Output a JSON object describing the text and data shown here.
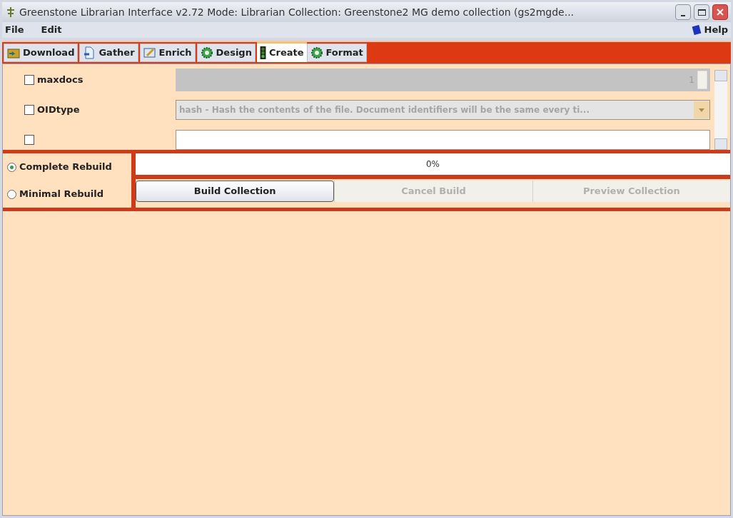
{
  "window": {
    "title": "Greenstone Librarian Interface v2.72  Mode: Librarian  Collection: Greenstone2 MG demo collection (gs2mgde..."
  },
  "menu": {
    "items": [
      "File",
      "Edit"
    ],
    "help": "Help"
  },
  "tabs": [
    {
      "label": "Download",
      "selected": false
    },
    {
      "label": "Gather",
      "selected": false
    },
    {
      "label": "Enrich",
      "selected": false
    },
    {
      "label": "Design",
      "selected": false
    },
    {
      "label": "Create",
      "selected": true
    },
    {
      "label": "Format",
      "selected": false
    }
  ],
  "options": [
    {
      "kind": "spinner",
      "label": "maxdocs",
      "checked": false,
      "value": "1"
    },
    {
      "kind": "dropdown",
      "label": "OIDtype",
      "checked": false,
      "value": "hash - Hash the contents of the file. Document identifiers will be the same every ti..."
    },
    {
      "kind": "cut",
      "checked": false
    }
  ],
  "rebuild": [
    {
      "label": "Complete Rebuild",
      "selected": true
    },
    {
      "label": "Minimal Rebuild",
      "selected": false
    }
  ],
  "progress": {
    "level": 0,
    "reading": "0%"
  },
  "buttons": [
    {
      "label": "Build Collection",
      "disabled": false
    },
    {
      "label": "Cancel Build",
      "disabled": true
    },
    {
      "label": "Preview Collection",
      "disabled": true
    }
  ]
}
